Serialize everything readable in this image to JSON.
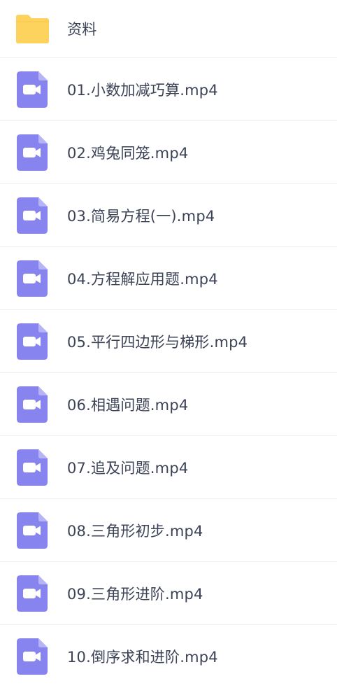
{
  "folder": {
    "name": "资料",
    "icon": "folder-icon",
    "color": "#fdd35d"
  },
  "videos": [
    {
      "name": "01.小数加减巧算.mp4",
      "icon": "video-file-icon"
    },
    {
      "name": "02.鸡兔同笼.mp4",
      "icon": "video-file-icon"
    },
    {
      "name": "03.简易方程(一).mp4",
      "icon": "video-file-icon"
    },
    {
      "name": "04.方程解应用题.mp4",
      "icon": "video-file-icon"
    },
    {
      "name": "05.平行四边形与梯形.mp4",
      "icon": "video-file-icon"
    },
    {
      "name": "06.相遇问题.mp4",
      "icon": "video-file-icon"
    },
    {
      "name": "07.追及问题.mp4",
      "icon": "video-file-icon"
    },
    {
      "name": "08.三角形初步.mp4",
      "icon": "video-file-icon"
    },
    {
      "name": "09.三角形进阶.mp4",
      "icon": "video-file-icon"
    },
    {
      "name": "10.倒序求和进阶.mp4",
      "icon": "video-file-icon"
    }
  ],
  "colors": {
    "video_icon": "#8783ef",
    "video_icon_fold": "#b6b3f6",
    "text": "#3c4356",
    "divider": "#eef0f4"
  }
}
